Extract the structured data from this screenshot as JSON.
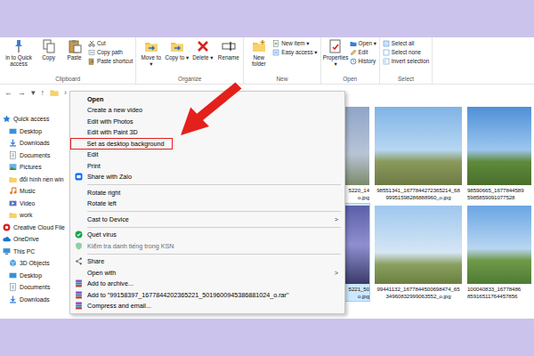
{
  "ribbon": {
    "groups": [
      {
        "label": "Clipboard",
        "large": [
          "in to Quick access",
          "Copy",
          "Paste"
        ],
        "small": [
          "Cut",
          "Copy path",
          "Paste shortcut"
        ]
      },
      {
        "label": "Organize",
        "large": [
          "Move to ▾",
          "Copy to ▾",
          "Delete ▾",
          "Rename"
        ],
        "small": []
      },
      {
        "label": "New",
        "large": [
          "New folder"
        ],
        "small": [
          "New item ▾",
          "Easy access ▾"
        ]
      },
      {
        "label": "Open",
        "large": [
          "Properties ▾"
        ],
        "small": [
          "Open ▾",
          "Edit",
          "History"
        ]
      },
      {
        "label": "Select",
        "large": [],
        "small": [
          "Select all",
          "Select none",
          "Invert selection"
        ]
      }
    ]
  },
  "address": {
    "back": "←",
    "forward": "→",
    "recent": "▾",
    "up": "↑",
    "separator": "›"
  },
  "nav": {
    "items": [
      {
        "label": "Quick access",
        "kind": "root"
      },
      {
        "label": "Desktop",
        "kind": "child"
      },
      {
        "label": "Downloads",
        "kind": "child"
      },
      {
        "label": "Documents",
        "kind": "child"
      },
      {
        "label": "Pictures",
        "kind": "child"
      },
      {
        "label": "đổi hình nền win",
        "kind": "child"
      },
      {
        "label": "Music",
        "kind": "child"
      },
      {
        "label": "Video",
        "kind": "child"
      },
      {
        "label": "work",
        "kind": "child"
      },
      {
        "label": "Creative Cloud File",
        "kind": "root"
      },
      {
        "label": "OneDrive",
        "kind": "root"
      },
      {
        "label": "This PC",
        "kind": "root"
      },
      {
        "label": "3D Objects",
        "kind": "child"
      },
      {
        "label": "Desktop",
        "kind": "child"
      },
      {
        "label": "Documents",
        "kind": "child"
      },
      {
        "label": "Downloads",
        "kind": "child"
      }
    ]
  },
  "files": [
    {
      "caption": [
        "5220_14",
        "o.jpg"
      ],
      "selected": false
    },
    {
      "caption": [
        "98551341_1677844272365214_68",
        "99951598286888960_o.jpg"
      ],
      "selected": false
    },
    {
      "caption": [
        "98590665_1677844589",
        "5985859091077528"
      ],
      "selected": false
    },
    {
      "caption": [
        "5221_50",
        "o.jpg"
      ],
      "selected": true
    },
    {
      "caption": [
        "99441132_1677844500698474_65",
        "34960832999063552_o.jpg"
      ],
      "selected": false
    },
    {
      "caption": [
        "100040833_16778486",
        "85916511764457856"
      ],
      "selected": false
    }
  ],
  "context_menu": {
    "items": [
      {
        "kind": "item",
        "label": "Open",
        "bold": true,
        "disabled": false,
        "highlighted": false
      },
      {
        "kind": "item",
        "label": "Create a new video",
        "bold": false,
        "disabled": false,
        "highlighted": false
      },
      {
        "kind": "item",
        "label": "Edit with Photos",
        "bold": false,
        "disabled": false,
        "highlighted": false
      },
      {
        "kind": "item",
        "label": "Edit with Paint 3D",
        "bold": false,
        "disabled": false,
        "highlighted": false
      },
      {
        "kind": "item",
        "label": "Set as desktop background",
        "bold": false,
        "disabled": false,
        "highlighted": true
      },
      {
        "kind": "item",
        "label": "Edit",
        "bold": false,
        "disabled": false,
        "highlighted": false
      },
      {
        "kind": "item",
        "label": "Print",
        "bold": false,
        "disabled": false,
        "highlighted": false
      },
      {
        "kind": "item",
        "label": "Share with Zalo",
        "bold": false,
        "disabled": false,
        "highlighted": false
      },
      {
        "kind": "separator"
      },
      {
        "kind": "item",
        "label": "Rotate right",
        "bold": false,
        "disabled": false,
        "highlighted": false
      },
      {
        "kind": "item",
        "label": "Rotate left",
        "bold": false,
        "disabled": false,
        "highlighted": false
      },
      {
        "kind": "separator"
      },
      {
        "kind": "submenu",
        "label": "Cast to Device",
        "arrow": ">",
        "bold": false,
        "disabled": false,
        "highlighted": false
      },
      {
        "kind": "separator"
      },
      {
        "kind": "item",
        "label": "Quét virus",
        "bold": false,
        "disabled": false,
        "highlighted": false
      },
      {
        "kind": "item",
        "label": "Kiểm tra danh tiếng trong KSN",
        "bold": false,
        "disabled": true,
        "highlighted": false
      },
      {
        "kind": "separator"
      },
      {
        "kind": "item",
        "label": "Share",
        "bold": false,
        "disabled": false,
        "highlighted": false
      },
      {
        "kind": "submenu",
        "label": "Open with",
        "arrow": ">",
        "bold": false,
        "disabled": false,
        "highlighted": false
      },
      {
        "kind": "item",
        "label": "Add to archive...",
        "bold": false,
        "disabled": false,
        "highlighted": false
      },
      {
        "kind": "item",
        "label": "Add to \"99158397_1677844202365221_5019600945386881024_o.rar\"",
        "bold": false,
        "disabled": false,
        "highlighted": false
      },
      {
        "kind": "item",
        "label": "Compress and email...",
        "bold": false,
        "disabled": false,
        "highlighted": false
      }
    ]
  }
}
